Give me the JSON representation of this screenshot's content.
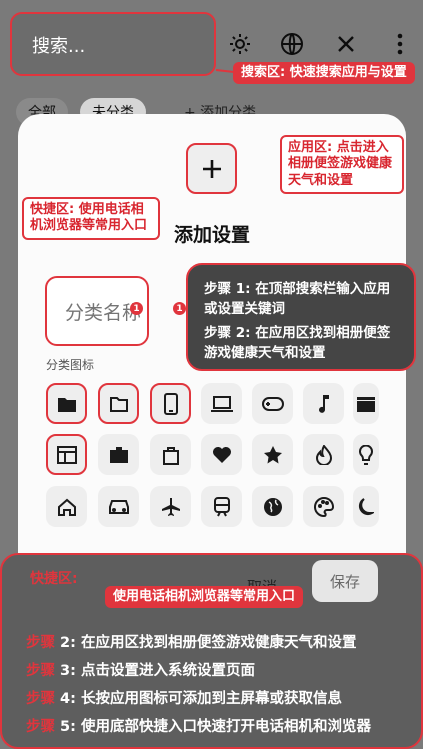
{
  "search": {
    "placeholder": "搜索..."
  },
  "toolbar": {
    "icons": [
      "sun-icon",
      "globe-icon",
      "close-icon",
      "more-vertical-icon"
    ]
  },
  "tabs": [
    {
      "label": "全部"
    },
    {
      "label": "未分类"
    },
    {
      "label": "+ 添加分类"
    }
  ],
  "annotations": {
    "search_area": "搜索区: 快速搜索应用与设置",
    "app_area": "应用区: 点击进入相册便签游戏健康天气和设置",
    "quick_area": "快捷区: 使用电话相机浏览器等常用入口",
    "quick_area_bottom": "使用电话相机浏览器等常用入口"
  },
  "dialog": {
    "title": "添加设置",
    "name_placeholder": "分类名称",
    "icon_section_label": "分类图标",
    "cancel": "取消",
    "save": "保存"
  },
  "marker": {
    "number": "1"
  },
  "steps_box": {
    "s1": "步骤 1: 在顶部搜索栏输入应用或设置关键词",
    "s2": "步骤 2: 在应用区找到相册便签游戏健康天气和设置"
  },
  "bottom": {
    "label": "快捷区:",
    "steps": [
      {
        "key": "步骤",
        "text": " 2: 在应用区找到相册便签游戏健康天气和设置"
      },
      {
        "key": "步骤",
        "text": " 3: 点击设置进入系统设置页面"
      },
      {
        "key": "步骤",
        "text": " 4: 长按应用图标可添加到主屏幕或获取信息"
      },
      {
        "key": "步骤",
        "text": " 5: 使用底部快捷入口快速打开电话相机和浏览器"
      }
    ]
  },
  "icon_grid": [
    [
      "folder-icon",
      "folder-outline-icon",
      "phone-icon",
      "laptop-icon",
      "gamepad-icon",
      "music-note-icon",
      "clapperboard-icon"
    ],
    [
      "layout-icon",
      "briefcase-icon",
      "shopping-bag-icon",
      "heart-icon",
      "star-icon",
      "fire-icon",
      "lightbulb-icon"
    ],
    [
      "home-icon",
      "car-icon",
      "airplane-icon",
      "train-icon",
      "globe-icon",
      "palette-icon",
      "moon-icon"
    ]
  ],
  "selected_icons": [
    "folder-icon",
    "folder-outline-icon",
    "phone-icon",
    "layout-icon"
  ],
  "colors": {
    "accent": "#e0353d",
    "overlay": "#454545"
  }
}
